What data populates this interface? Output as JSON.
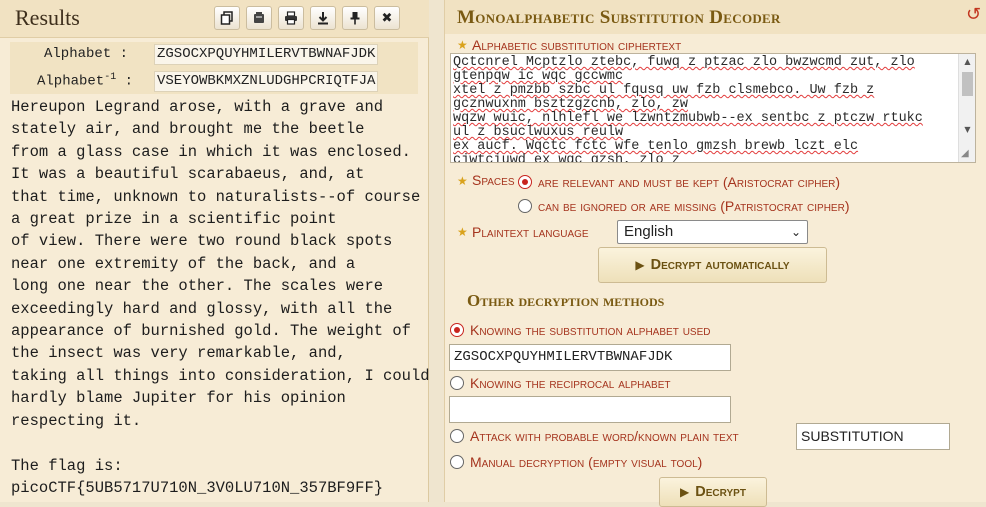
{
  "results": {
    "title": "Results",
    "toolbar": [
      {
        "name": "copy-icon"
      },
      {
        "name": "clear-icon"
      },
      {
        "name": "print-icon"
      },
      {
        "name": "download-icon"
      },
      {
        "name": "pin-icon"
      },
      {
        "name": "close-icon"
      }
    ],
    "alphabet_label": "Alphabet :",
    "alphabet_value": "ZGSOCXPQUYHMILERVTBWNAFJDK",
    "inverse_label_base": "Alphabet",
    "inverse_label_sup": "-1",
    "inverse_label_colon": " :",
    "inverse_value": "VSEYOWBKMXZNLUDGHPCRIQTFJA",
    "decoded_text": "Hereupon Legrand arose, with a grave and\nstately air, and brought me the beetle\nfrom a glass case in which it was enclosed.\nIt was a beautiful scarabaeus, and, at\nthat time, unknown to naturalists--of course\na great prize in a scientific point\nof view. There were two round black spots\nnear one extremity of the back, and a\nlong one near the other. The scales were\nexceedingly hard and glossy, with all the\nappearance of burnished gold. The weight of\nthe insect was very remarkable, and,\ntaking all things into consideration, I could\nhardly blame Jupiter for his opinion\nrespecting it.\n\nThe flag is:\npicoCTF{5UB5717U710N_3V0LU710N_357BF9FF}"
  },
  "decoder": {
    "title": "Monoalphabetic Substitution Decoder",
    "reset_icon": "reset-icon",
    "ciphertext_label": "Alphabetic substitution ciphertext",
    "ciphertext_value": "Qctcnrel Mcptzlo ztebc, fuwq z ptzac zlo bwzwcmd zut, zlo\ngtenpqw ic wqc gccwmc\nxtel z pmzbb szbc ul fqusq uw fzb clsmebco. Uw fzb z\ngcznwuxnm bsztzgzcnb, zlo, zw\nwqzw wuic, nlhlefl we lzwntzmubwb--ex sentbc z ptczw rtukc\nul z bsuclwuxus reulw\nex aucf. Wqctc fctc wfe tenlo gmzsh brewb lczt elc\ncjwtciuwd ex wqc gzsh, zlo z",
    "spaces_label": "Spaces",
    "spaces_options": [
      {
        "label": "are relevant and must be kept (Aristocrat cipher)",
        "checked": true
      },
      {
        "label": "can be ignored or are missing (Patristocrat cipher)",
        "checked": false
      }
    ],
    "language_label": "Plaintext language",
    "language_value": "English",
    "decrypt_auto_label": "Decrypt automatically",
    "other_methods_title": "Other decryption methods",
    "methods": [
      {
        "label": "Knowing the substitution alphabet used",
        "checked": true
      },
      {
        "label": "Knowing the reciprocal alphabet",
        "checked": false
      },
      {
        "label": "Attack with probable word/known plain text",
        "checked": false
      },
      {
        "label": "Manual decryption (empty visual tool)",
        "checked": false
      }
    ],
    "substitution_alphabet_value": "ZGSOCXPQUYHMILERVTBWNAFJDK",
    "reciprocal_alphabet_value": "",
    "known_plaintext_value": "SUBSTITUTION",
    "decrypt_label": "Decrypt"
  },
  "colors": {
    "label_red": "#a5341e",
    "title_gold": "#7a5a12",
    "panel_bg": "#f7ecd6"
  }
}
